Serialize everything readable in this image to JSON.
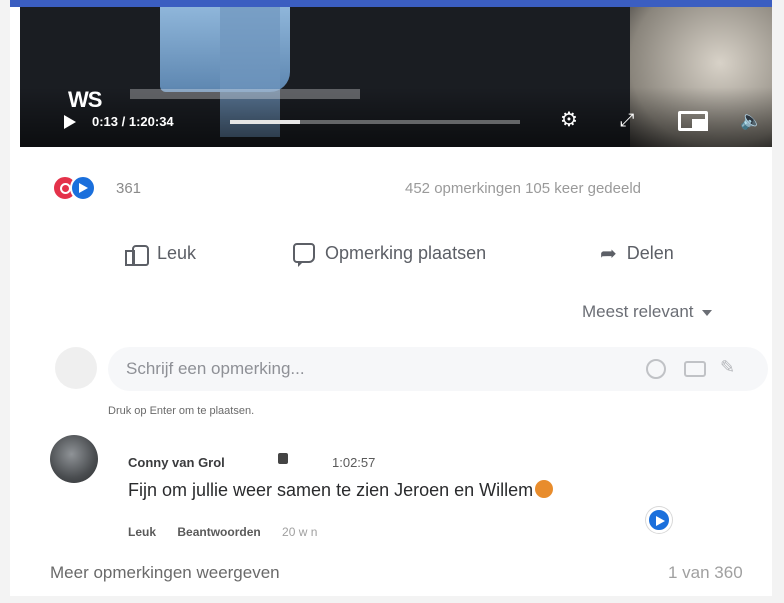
{
  "video": {
    "logo_text": "WS",
    "time": "0:13 / 1:20:34",
    "progress_fraction": 0.24,
    "controls": {
      "settings_icon": "gear-icon",
      "fullscreen_icon": "expand-icon",
      "pip_icon": "picture-in-picture-icon",
      "volume_icon": "volume-icon"
    }
  },
  "stats": {
    "reaction_icons": [
      "heart-icon",
      "like-icon"
    ],
    "reaction_count": "361",
    "comments_shares": "452 opmerkingen  105 keer gedeeld"
  },
  "actions": {
    "like_label": "Leuk",
    "comment_label": "Opmerking plaatsen",
    "share_label": "Delen"
  },
  "sort": {
    "selected": "Meest relevant"
  },
  "composer": {
    "placeholder": "Schrijf een opmerking...",
    "hint": "Druk op Enter om te plaatsen.",
    "icons": [
      "emoji-icon",
      "camera-icon",
      "sticker-icon"
    ]
  },
  "comment": {
    "author": "Conny van Grol",
    "time": "1:02:57",
    "text": "Fijn om jullie weer samen te zien Jeroen en Willem",
    "like_label": "Leuk",
    "reply_label": "Beantwoorden",
    "age": "20 w n"
  },
  "footer": {
    "more_label": "Meer opmerkingen weergeven",
    "pager": "1 van 360"
  },
  "colors": {
    "accent": "#1a6fdc",
    "heart": "#e4324a",
    "top_band": "#3b5ec1"
  }
}
